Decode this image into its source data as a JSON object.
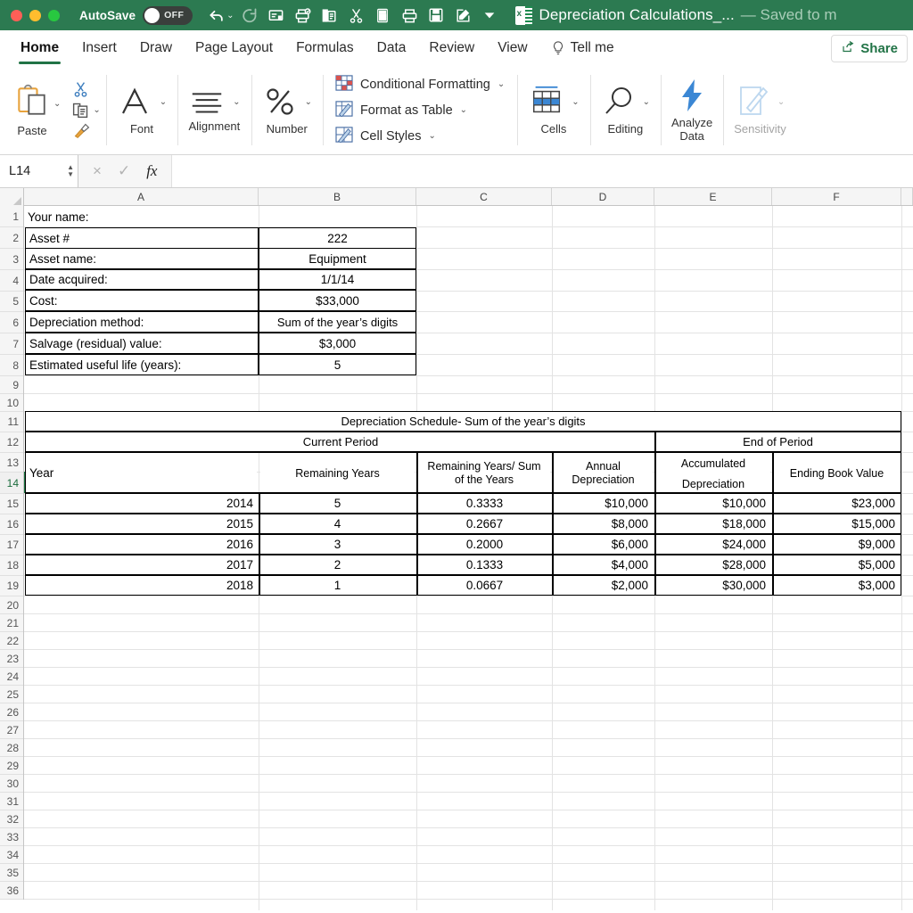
{
  "titlebar": {
    "autosave_label": "AutoSave",
    "autosave_state": "OFF",
    "doc_title": "Depreciation Calculations_...",
    "saved_status": "— Saved to m",
    "accent_color": "#2c7a51",
    "quick_access": [
      {
        "name": "undo-icon",
        "label": "Undo"
      },
      {
        "name": "redo-icon",
        "label": "Redo"
      },
      {
        "name": "new-comment-icon",
        "label": "New Comment"
      },
      {
        "name": "print-preview-icon",
        "label": "Print Preview"
      },
      {
        "name": "copy-icon",
        "label": "Copy"
      },
      {
        "name": "cut-icon",
        "label": "Cut"
      },
      {
        "name": "calculator-icon",
        "label": "Calculator"
      },
      {
        "name": "print-icon",
        "label": "Print"
      },
      {
        "name": "save-icon",
        "label": "Save"
      },
      {
        "name": "edit-icon",
        "label": "Edit"
      },
      {
        "name": "customize-toolbar-icon",
        "label": "Customize"
      }
    ]
  },
  "tabs": [
    {
      "label": "Home",
      "active": true
    },
    {
      "label": "Insert",
      "active": false
    },
    {
      "label": "Draw",
      "active": false
    },
    {
      "label": "Page Layout",
      "active": false
    },
    {
      "label": "Formulas",
      "active": false
    },
    {
      "label": "Data",
      "active": false
    },
    {
      "label": "Review",
      "active": false
    },
    {
      "label": "View",
      "active": false
    }
  ],
  "tellme_label": "Tell me",
  "share_label": "Share",
  "ribbon": {
    "paste_label": "Paste",
    "font_label": "Font",
    "alignment_label": "Alignment",
    "number_label": "Number",
    "conditional_formatting_label": "Conditional Formatting",
    "format_as_table_label": "Format as Table",
    "cell_styles_label": "Cell Styles",
    "cells_label": "Cells",
    "editing_label": "Editing",
    "analyze_data_label": "Analyze\nData",
    "analyze_data_line1": "Analyze",
    "analyze_data_line2": "Data",
    "sensitivity_label": "Sensitivity"
  },
  "formula_bar": {
    "name_box_value": "L14",
    "formula_value": "",
    "cancel_icon": "×",
    "confirm_icon": "✓",
    "fx_label": "fx"
  },
  "grid": {
    "column_headers": [
      "A",
      "B",
      "C",
      "D",
      "E",
      "F"
    ],
    "row_numbers": [
      1,
      2,
      3,
      4,
      5,
      6,
      7,
      8,
      9,
      10,
      11,
      12,
      13,
      14,
      15,
      16,
      17,
      18,
      19,
      20,
      21,
      22,
      23,
      24,
      25,
      26,
      27,
      28,
      29,
      30,
      31,
      32,
      33,
      34,
      35,
      36
    ],
    "selected_row": 14,
    "selected_cell": "L14"
  },
  "asset_info": {
    "rows": [
      {
        "label": "Your name:",
        "value": ""
      },
      {
        "label": "Asset #",
        "value": "222"
      },
      {
        "label": "Asset name:",
        "value": "Equipment"
      },
      {
        "label": "Date acquired:",
        "value": "1/1/14"
      },
      {
        "label": "Cost:",
        "value": "$33,000"
      },
      {
        "label": "Depreciation method:",
        "value": "Sum of the year’s digits"
      },
      {
        "label": "Salvage (residual) value:",
        "value": "$3,000"
      },
      {
        "label": "Estimated useful life (years):",
        "value": "5"
      }
    ]
  },
  "chart_data": {
    "type": "table",
    "title": "Depreciation Schedule- Sum of the year’s digits",
    "group_headers": [
      {
        "label": "Current Period",
        "span": 3
      },
      {
        "label": "End of Period",
        "span": 2
      }
    ],
    "columns": [
      "Year",
      "Remaining Years",
      "Remaining Years/ Sum of the Years",
      "Annual Depreciation",
      "Accumulated Depreciation",
      "Ending Book Value"
    ],
    "column_lines": [
      [
        "Year"
      ],
      [
        "Remaining Years"
      ],
      [
        "Remaining Years/ Sum",
        "of the Years"
      ],
      [
        "Annual",
        "Depreciation"
      ],
      [
        "Accumulated",
        "Depreciation"
      ],
      [
        "Ending Book Value"
      ]
    ],
    "rows": [
      [
        "2014",
        "5",
        "0.3333",
        "$10,000",
        "$10,000",
        "$23,000"
      ],
      [
        "2015",
        "4",
        "0.2667",
        "$8,000",
        "$18,000",
        "$15,000"
      ],
      [
        "2016",
        "3",
        "0.2000",
        "$6,000",
        "$24,000",
        "$9,000"
      ],
      [
        "2017",
        "2",
        "0.1333",
        "$4,000",
        "$28,000",
        "$5,000"
      ],
      [
        "2018",
        "1",
        "0.0667",
        "$2,000",
        "$30,000",
        "$3,000"
      ]
    ]
  }
}
